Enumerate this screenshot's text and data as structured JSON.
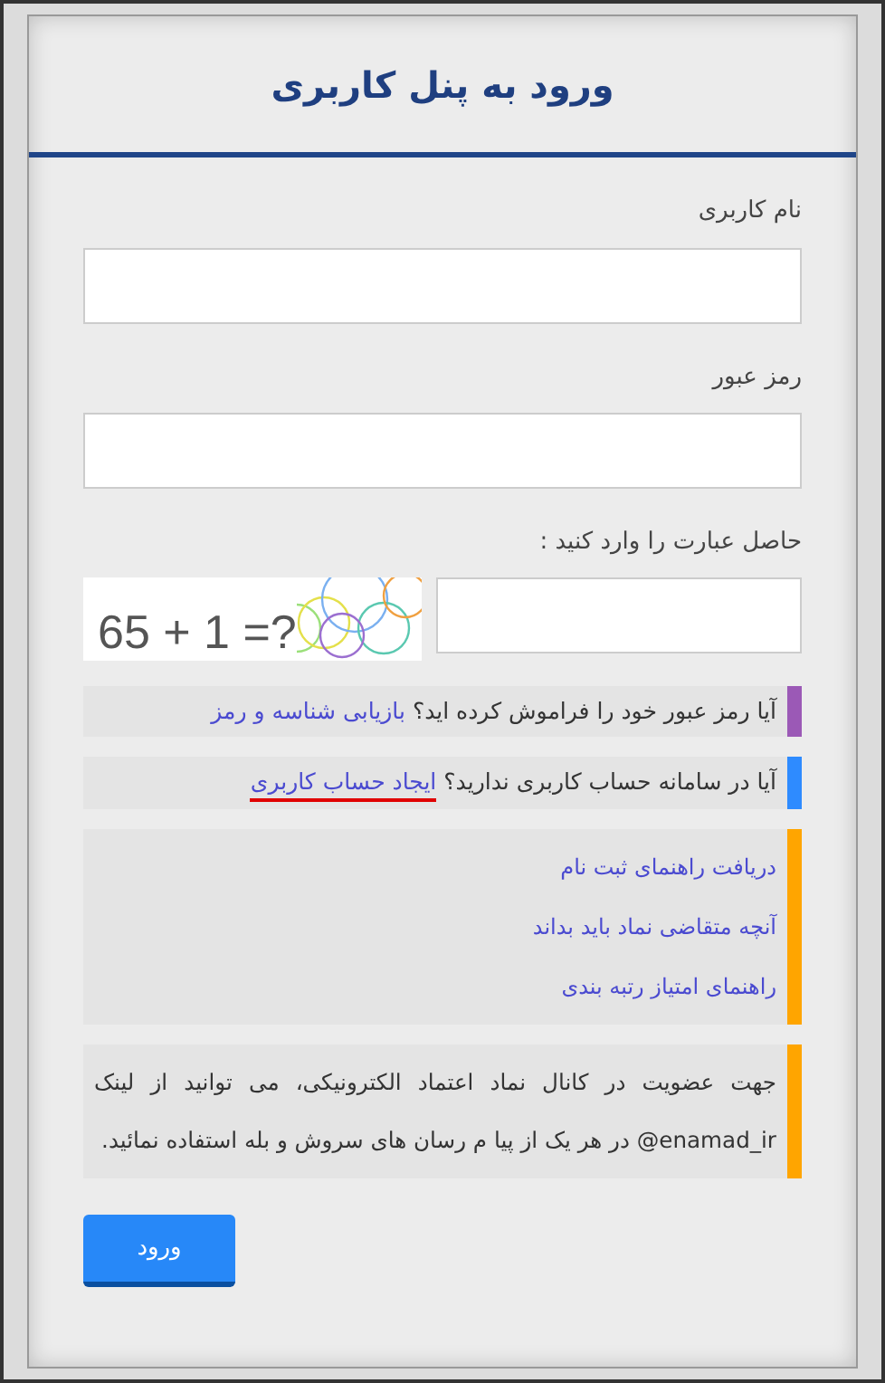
{
  "title": "ورود به پنل کاربری",
  "fields": [
    {
      "label": "نام کاربری"
    },
    {
      "label": "رمز عبور"
    }
  ],
  "captcha": {
    "label": "حاصل عبارت را وارد کنید :",
    "image_text": "65 + 1 =?"
  },
  "notes": [
    {
      "kind": "sentence",
      "color": "#9b59b6",
      "text": "آیا رمز عبور خود را فراموش کرده اید؟",
      "link": "بازیابی شناسه و رمز",
      "underlined": false
    },
    {
      "kind": "sentence",
      "color": "#2e8bff",
      "text": "آیا در سامانه حساب کاربری ندارید؟",
      "link": "ایجاد حساب کاربری",
      "underlined": true
    },
    {
      "kind": "links",
      "color": "#ffa500",
      "links": [
        "دریافت راهنمای ثبت نام",
        "آنچه متقاضی نماد باید بداند",
        "راهنمای امتیاز رتبه بندی"
      ]
    },
    {
      "kind": "paragraph",
      "color": "#ffa500",
      "text": "جهت عضویت در کانال نماد اعتماد الکترونیکی، می توانید از لینک enamad_ir@ در هر یک از پیا م رسان های سروش و بله استفاده نمائید."
    }
  ],
  "submit": "ورود"
}
